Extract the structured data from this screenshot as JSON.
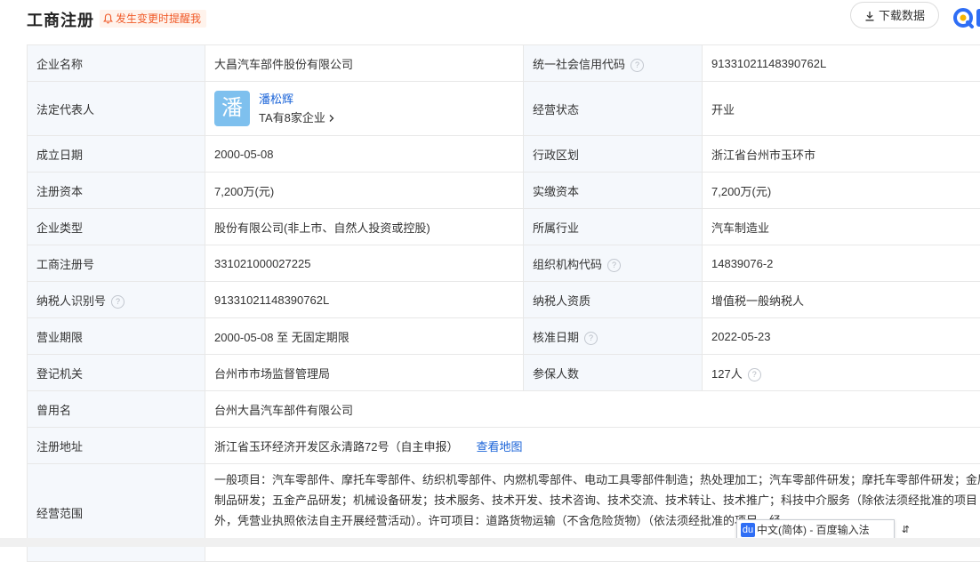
{
  "header": {
    "title": "工商注册",
    "alert_text": "发生变更时提醒我",
    "download_label": "下载数据"
  },
  "rows": [
    {
      "l1": "企业名称",
      "v1": "大昌汽车部件股份有限公司",
      "l2": "统一社会信用代码",
      "v2": "91331021148390762L"
    },
    {
      "l1": "法定代表人",
      "l2": "经营状态",
      "v2": "开业"
    },
    {
      "l1": "成立日期",
      "v1": "2000-05-08",
      "l2": "行政区划",
      "v2": "浙江省台州市玉环市"
    },
    {
      "l1": "注册资本",
      "v1": "7,200万(元)",
      "l2": "实缴资本",
      "v2": "7,200万(元)"
    },
    {
      "l1": "企业类型",
      "v1": "股份有限公司(非上市、自然人投资或控股)",
      "l2": "所属行业",
      "v2": "汽车制造业"
    },
    {
      "l1": "工商注册号",
      "v1": "331021000027225",
      "l2": "组织机构代码",
      "v2": "14839076-2"
    },
    {
      "l1": "纳税人识别号",
      "v1": "91331021148390762L",
      "l2": "纳税人资质",
      "v2": "增值税一般纳税人"
    },
    {
      "l1": "营业期限",
      "v1": "2000-05-08 至 无固定期限",
      "l2": "核准日期",
      "v2": "2022-05-23"
    },
    {
      "l1": "登记机关",
      "v1": "台州市市场监督管理局",
      "l2": "参保人数",
      "v2": "127人"
    },
    {
      "l1": "曾用名",
      "v1": "台州大昌汽车部件有限公司"
    },
    {
      "l1": "注册地址",
      "v1": "浙江省玉环经济开发区永清路72号（自主申报）",
      "link": "查看地图"
    },
    {
      "l1": "经营范围",
      "v1": "一般项目：汽车零部件、摩托车零部件、纺织机零部件、内燃机零部件、电动工具零部件制造；热处理加工；汽车零部件研发；摩托车零部件研发；金属制品研发；五金产品研发；机械设备研发；技术服务、技术开发、技术咨询、技术交流、技术转让、技术推广；科技中介服务（除依法须经批准的项目外，凭营业执照依法自主开展经营活动）。许可项目：道路货物运输（不含危险货物）（依法须经批准的项目，经"
    }
  ],
  "legal_rep": {
    "avatar_char": "潘",
    "name": "潘松辉",
    "companies": "TA有8家企业"
  },
  "ime": {
    "logo": "du",
    "text": "中文(简体) - 百度输入法"
  }
}
